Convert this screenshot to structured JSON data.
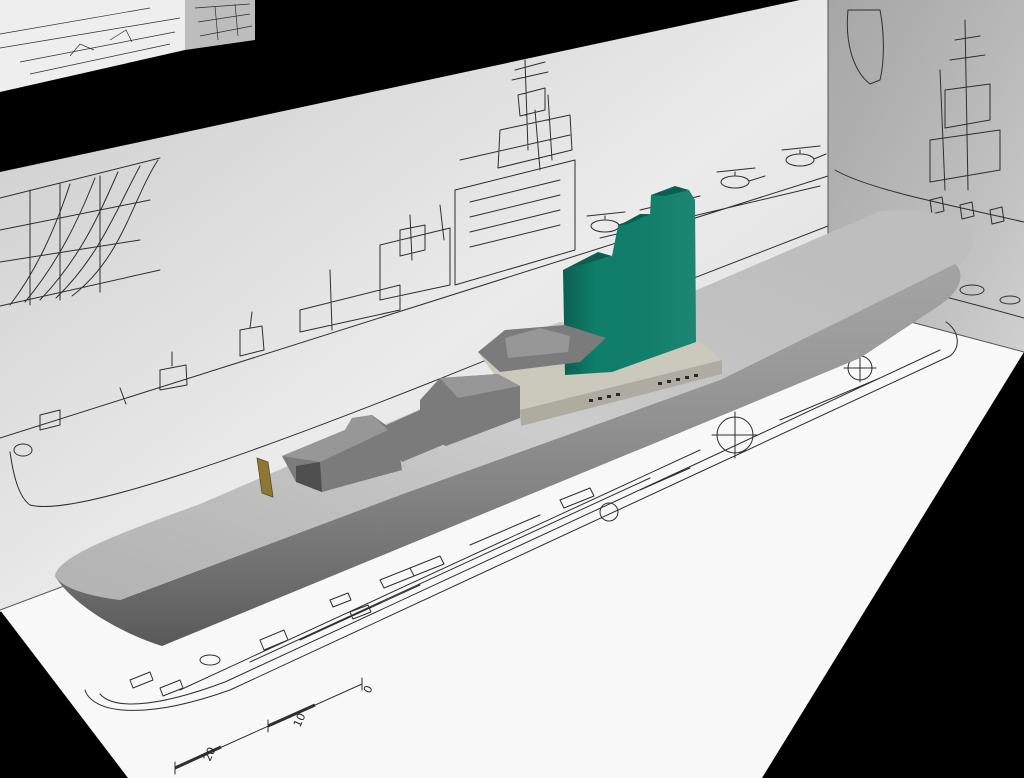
{
  "blueprint": {
    "scale_labels": [
      "0",
      "10",
      "20"
    ]
  },
  "colors": {
    "background": "#000000",
    "back_wall": "#ebebeb",
    "right_wall": "#c4c4c4",
    "floor": "#f8f8f8",
    "top_panel": "#eeeeee",
    "top_panel_side": "#bdbdbd",
    "drawing_line": "#2e2e2e",
    "hull": "#8f8f8f",
    "deck": "#c6c6c6",
    "hangar": "#cbc8bc",
    "hangar_front": "#aeaba0",
    "tower": "#0f7f6a",
    "tower_shade": "#0b5f51",
    "superstructure": "#7b7b7b",
    "superstructure_top": "#979797",
    "plate": "#8c7834"
  }
}
